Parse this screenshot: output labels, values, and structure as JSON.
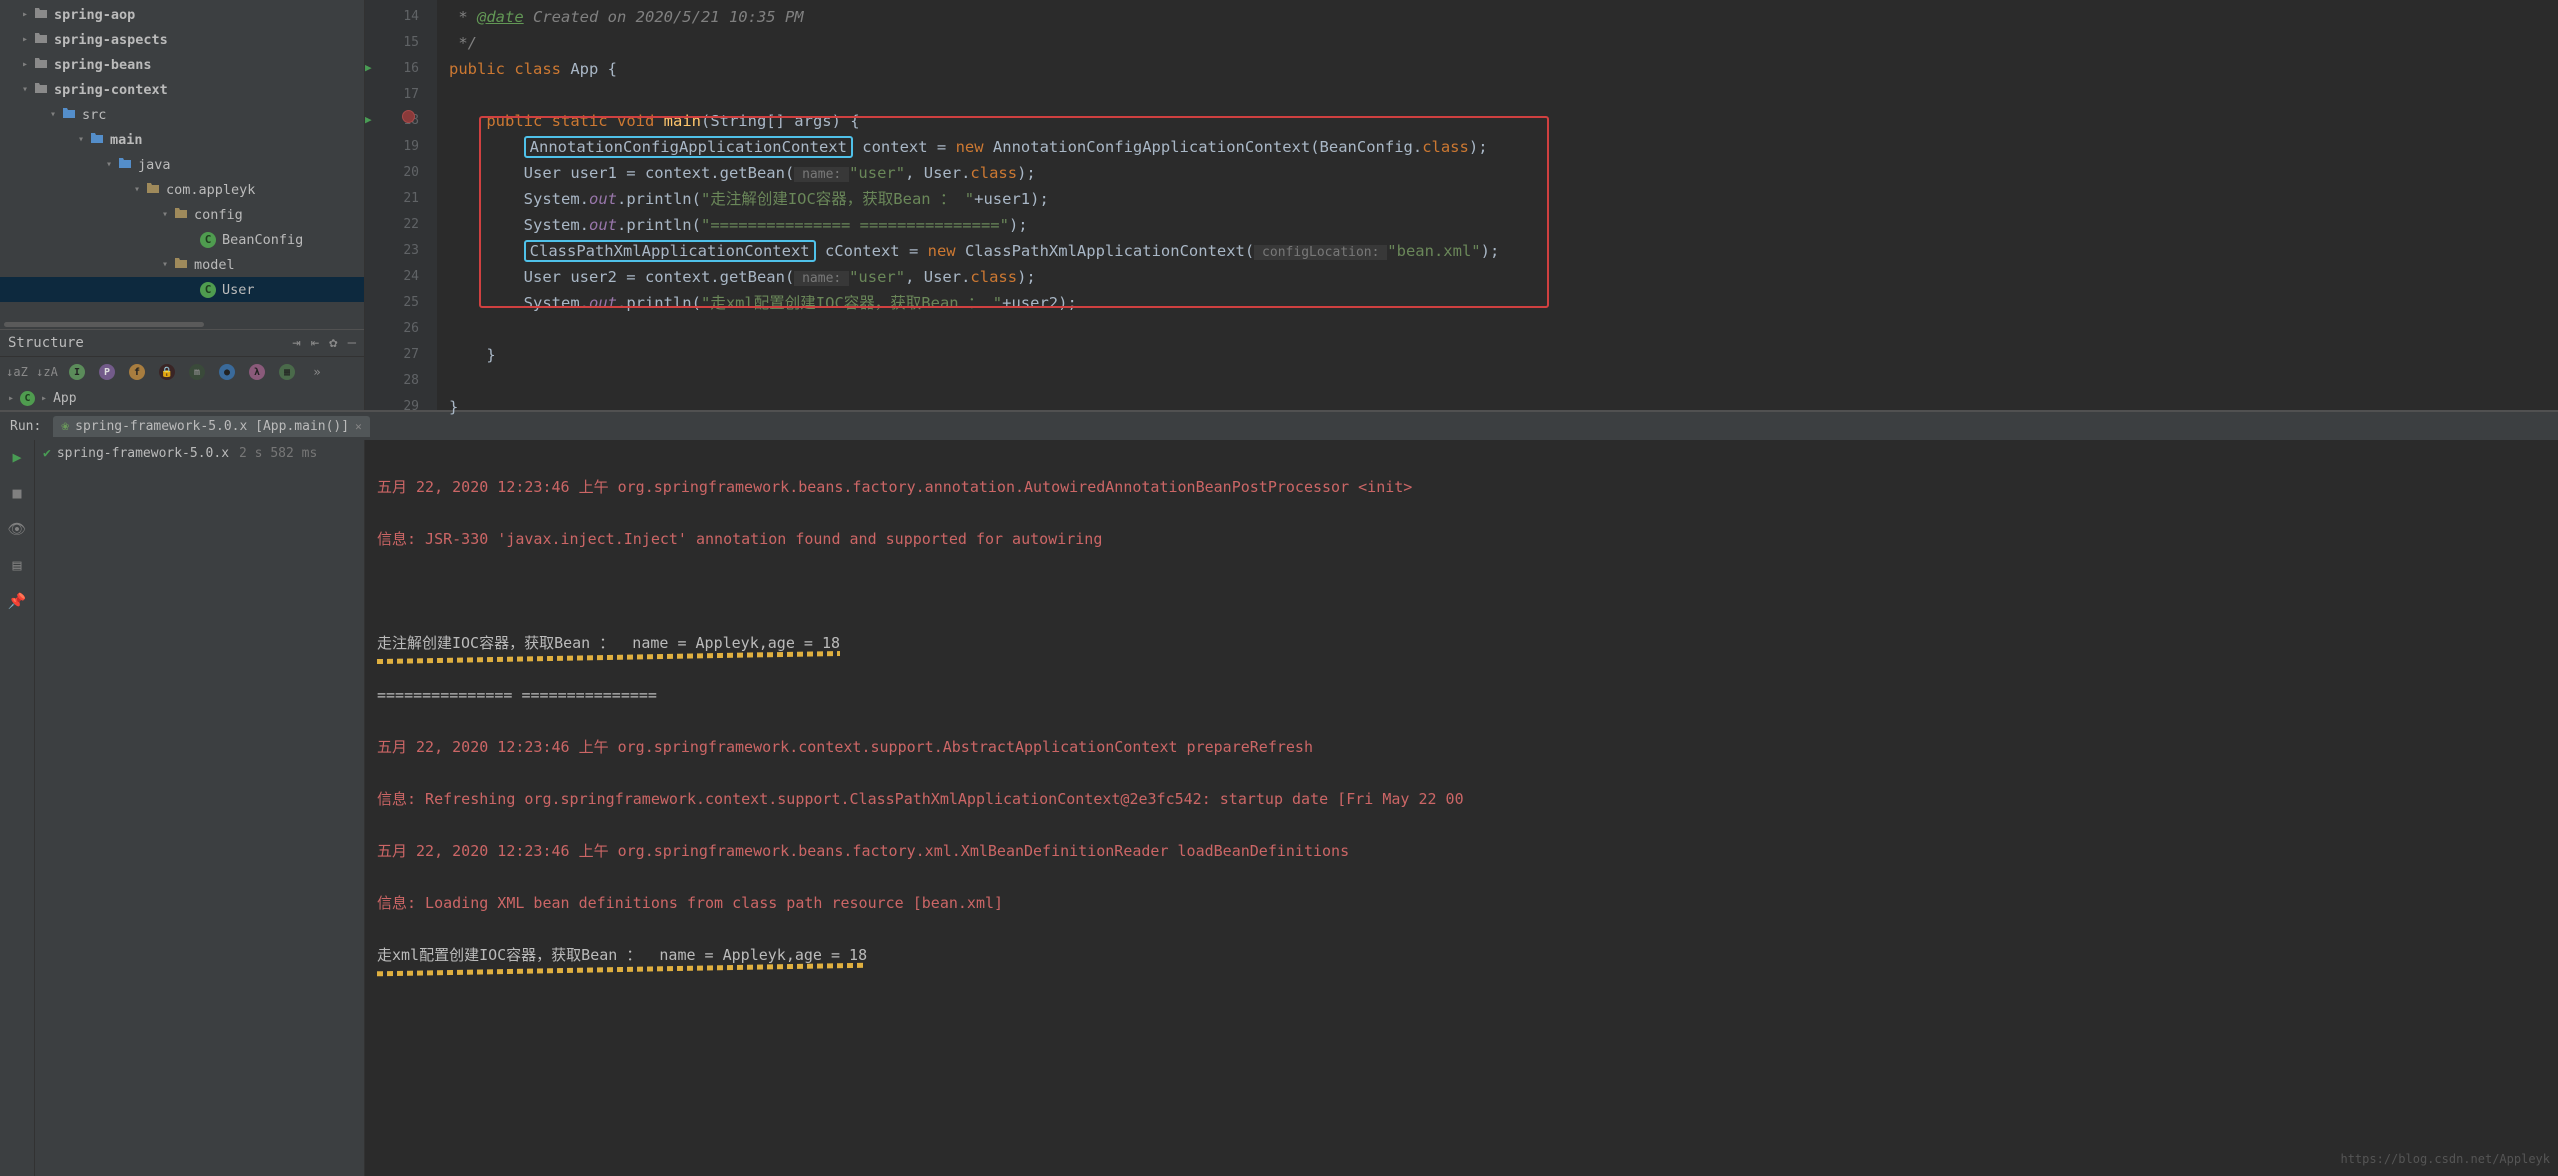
{
  "project": {
    "tree": [
      {
        "indent": 18,
        "expand": "▸",
        "iconClass": "folder-icon",
        "label": "spring-aop",
        "bold": true
      },
      {
        "indent": 18,
        "expand": "▸",
        "iconClass": "folder-icon",
        "label": "spring-aspects",
        "bold": true
      },
      {
        "indent": 18,
        "expand": "▸",
        "iconClass": "folder-icon",
        "label": "spring-beans",
        "bold": true
      },
      {
        "indent": 18,
        "expand": "▾",
        "iconClass": "folder-icon",
        "label": "spring-context",
        "bold": true
      },
      {
        "indent": 46,
        "expand": "▾",
        "iconClass": "folder-icon src-icon",
        "label": "src",
        "bold": false
      },
      {
        "indent": 74,
        "expand": "▾",
        "iconClass": "folder-icon mod-icon",
        "label": "main",
        "bold": true
      },
      {
        "indent": 102,
        "expand": "▾",
        "iconClass": "folder-icon mod-icon",
        "label": "java",
        "bold": false
      },
      {
        "indent": 130,
        "expand": "▾",
        "iconClass": "folder-icon pkg-icon",
        "label": "com.appleyk",
        "bold": false
      },
      {
        "indent": 158,
        "expand": "▾",
        "iconClass": "folder-icon pkg-icon",
        "label": "config",
        "bold": false
      },
      {
        "indent": 186,
        "expand": "",
        "iconClass": "class-icon",
        "iconText": "C",
        "label": "BeanConfig",
        "bold": false
      },
      {
        "indent": 158,
        "expand": "▾",
        "iconClass": "folder-icon pkg-icon",
        "label": "model",
        "bold": false
      },
      {
        "indent": 186,
        "expand": "",
        "iconClass": "class-icon",
        "iconText": "C",
        "label": "User",
        "bold": false,
        "selected": true
      }
    ]
  },
  "structure": {
    "title": "Structure",
    "app_label": "App"
  },
  "editor": {
    "line_numbers": [
      14,
      15,
      16,
      17,
      18,
      19,
      20,
      21,
      22,
      23,
      24,
      25,
      26,
      27,
      28,
      29
    ],
    "lines": {
      "14_prefix": " * ",
      "14_tag": "@date",
      "14_rest": " Created on 2020/5/21 10:35 PM",
      "15": " */",
      "16_pre": "public class ",
      "16_name": "App {",
      "18_pre": "    public static ",
      "18_void": "void ",
      "18_main": "main",
      "18_args": "(String[] args) {",
      "19_ind": "        ",
      "19_type": "AnnotationConfigApplicationContext",
      "19_mid": " context = ",
      "19_new": "new ",
      "19_ctor": "AnnotationConfigApplicationContext(BeanConfig.",
      "19_class": "class",
      "19_end": ");",
      "20": "        User user1 = context.getBean(",
      "20_hint": " name: ",
      "20_str": "\"user\"",
      "20_rest": ", User.",
      "20_class": "class",
      "20_end": ");",
      "21_pre": "        System.",
      "21_out": "out",
      "21_print": ".println(",
      "21_str": "\"走注解创建IOC容器，获取Bean ： \"",
      "21_end": "+user1);",
      "22_pre": "        System.",
      "22_out": "out",
      "22_print": ".println(",
      "22_str": "\"=============== ===============\"",
      "22_end": ");",
      "23_ind": "        ",
      "23_type": "ClassPathXmlApplicationContext",
      "23_mid": " cContext = ",
      "23_new": "new ",
      "23_ctor": "ClassPathXmlApplicationContext(",
      "23_hint": " configLocation: ",
      "23_str": "\"bean.xml\"",
      "23_end": ");",
      "24": "        User user2 = context.getBean(",
      "24_hint": " name: ",
      "24_str": "\"user\"",
      "24_rest": ", User.",
      "24_class": "class",
      "24_end": ");",
      "25_pre": "        System.",
      "25_out": "out",
      "25_print": ".println(",
      "25_str": "\"走xml配置创建IOC容器，获取Bean ： \"",
      "25_end": "+user2);",
      "27": "    }",
      "28": "",
      "29": "}"
    }
  },
  "run": {
    "header_label": "Run:",
    "tab_label": "spring-framework-5.0.x [App.main()]",
    "status": "spring-framework-5.0.x",
    "timing": "2 s 582 ms"
  },
  "console": {
    "l1": "五月 22, 2020 12:23:46 上午 org.springframework.beans.factory.annotation.AutowiredAnnotationBeanPostProcessor <init>",
    "l2": "信息: JSR-330 'javax.inject.Inject' annotation found and supported for autowiring",
    "l3": "走注解创建IOC容器，获取Bean ：  name = Appleyk,age = 18",
    "l4": "=============== ===============",
    "l5": "五月 22, 2020 12:23:46 上午 org.springframework.context.support.AbstractApplicationContext prepareRefresh",
    "l6": "信息: Refreshing org.springframework.context.support.ClassPathXmlApplicationContext@2e3fc542: startup date [Fri May 22 00",
    "l7": "五月 22, 2020 12:23:46 上午 org.springframework.beans.factory.xml.XmlBeanDefinitionReader loadBeanDefinitions",
    "l8": "信息: Loading XML bean definitions from class path resource [bean.xml]",
    "l9": "走xml配置创建IOC容器，获取Bean ：  name = Appleyk,age = 18"
  },
  "watermark": "https://blog.csdn.net/Appleyk"
}
